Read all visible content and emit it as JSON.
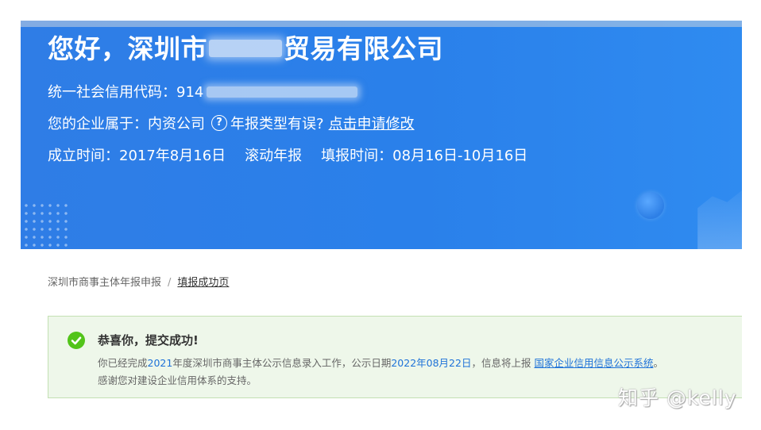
{
  "banner": {
    "greeting_prefix": "您好，深圳市",
    "greeting_suffix": "贸易有限公司",
    "credit_code_label": "统一社会信用代码：",
    "credit_code_visible": "914",
    "enterprise_type_label": "您的企业属于：",
    "enterprise_type": "内资公司",
    "report_type_question": "年报类型有误?",
    "apply_link": "点击申请修改",
    "founded_label": "成立时间：",
    "founded_date": "2017年8月16日",
    "report_mode": "滚动年报",
    "fill_period_label": "填报时间：",
    "fill_period": "08月16日-10月16日",
    "help_symbol": "?"
  },
  "breadcrumb": {
    "root": "深圳市商事主体年报申报",
    "separator": "/",
    "current": "填报成功页"
  },
  "success": {
    "title": "恭喜你，提交成功!",
    "msg_part1": "你已经完成",
    "msg_year": "2021",
    "msg_part2": "年度深圳市商事主体公示信息录入工作，公示日期",
    "msg_date": "2022年08月22日",
    "msg_part3": "，信息将上报",
    "system_link": "国家企业信用信息公示系统",
    "msg_part4": "。",
    "msg_line2": "感谢您对建设企业信用体系的支持。"
  },
  "watermark": "知乎 @kelly",
  "colors": {
    "banner_blue": "#2a80ea",
    "success_green": "#52c41a",
    "success_bg": "#eef7ea",
    "link_blue": "#1e72d8"
  }
}
